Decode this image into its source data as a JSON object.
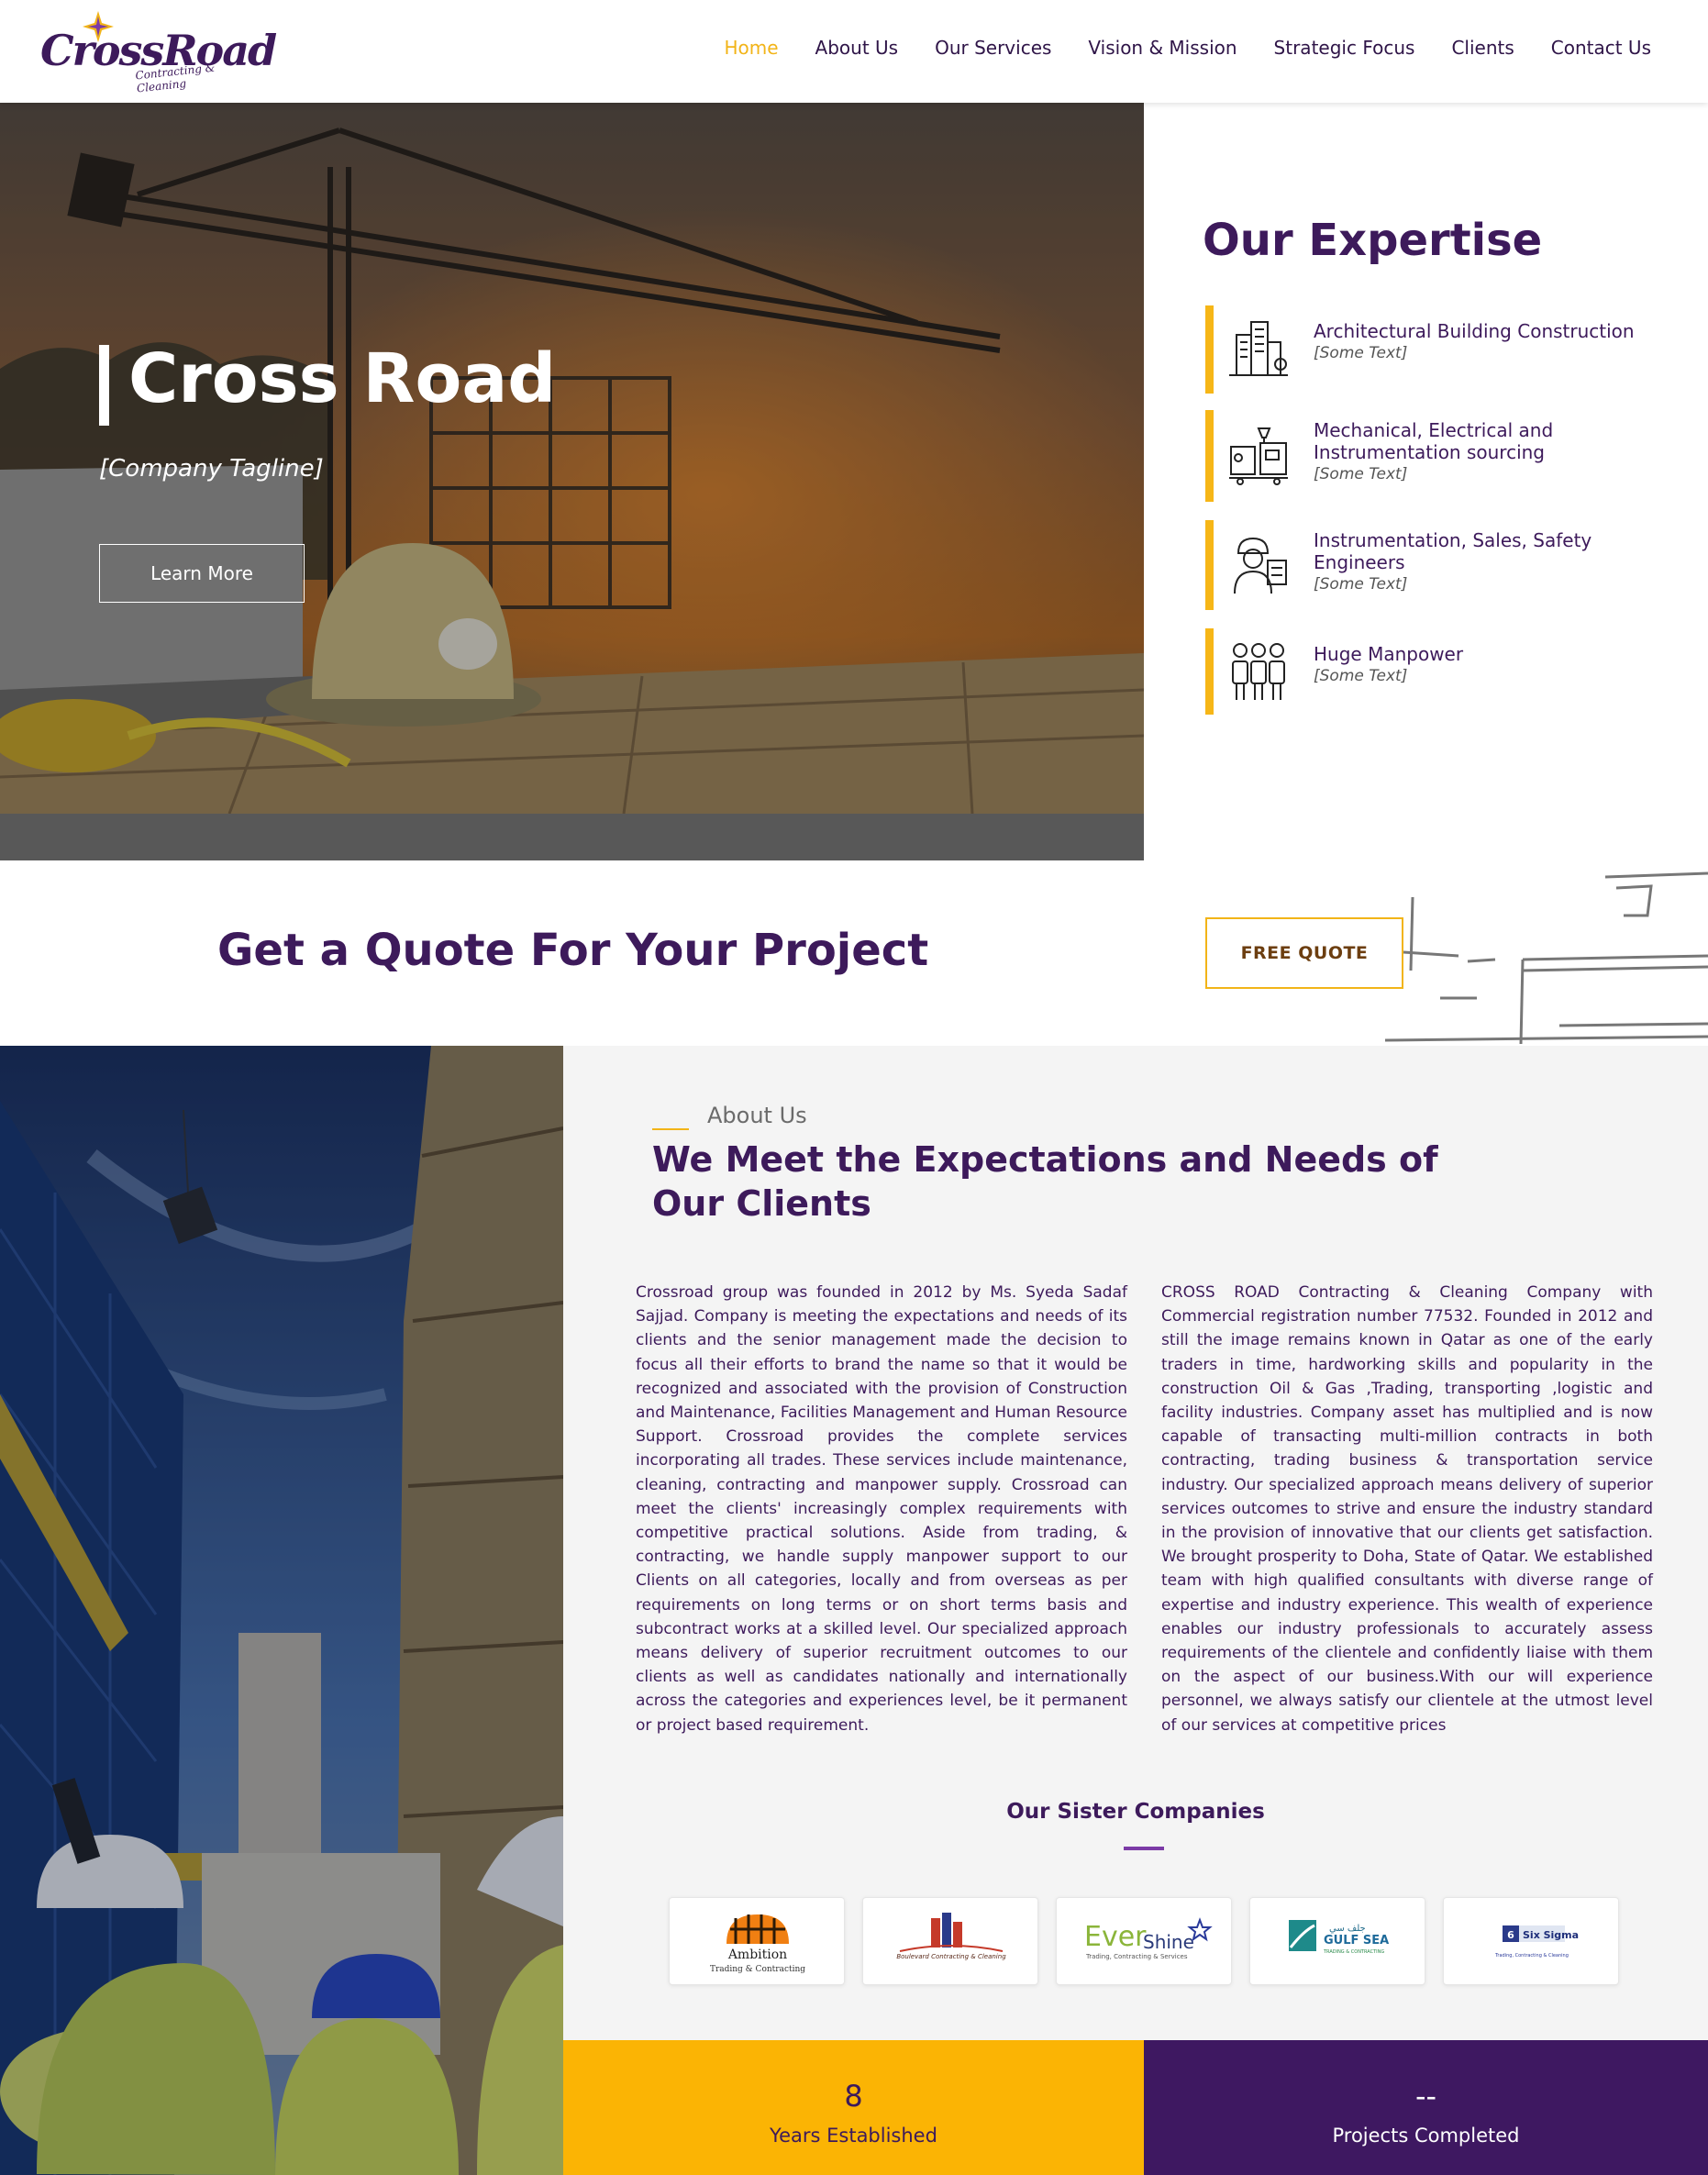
{
  "brand": {
    "logo_main": "CrossRoad",
    "logo_sub": "Contracting & Cleaning"
  },
  "nav": {
    "items": [
      {
        "label": "Home",
        "active": true
      },
      {
        "label": "About Us"
      },
      {
        "label": "Our Services"
      },
      {
        "label": "Vision & Mission"
      },
      {
        "label": "Strategic Focus"
      },
      {
        "label": "Clients"
      },
      {
        "label": "Contact Us"
      }
    ]
  },
  "hero": {
    "title": "Cross Road",
    "tagline": "[Company Tagline]",
    "button_label": "Learn More"
  },
  "expertise": {
    "title": "Our Expertise",
    "items": [
      {
        "name": "Architectural Building Construction",
        "sub": "[Some Text]",
        "icon": "buildings-icon"
      },
      {
        "name": "Mechanical, Electrical and Instrumentation sourcing",
        "sub": "[Some Text]",
        "icon": "machinery-icon"
      },
      {
        "name": "Instrumentation, Sales, Safety Engineers",
        "sub": "[Some Text]",
        "icon": "engineer-icon"
      },
      {
        "name": "Huge Manpower",
        "sub": "[Some Text]",
        "icon": "workers-group-icon"
      }
    ]
  },
  "quote": {
    "title": "Get a Quote For Your Project",
    "button_label": "FREE QUOTE"
  },
  "about": {
    "label": "About Us",
    "title": "We Meet the Expectations and Needs of Our Clients",
    "col1": "Crossroad group was founded in 2012 by Ms. Syeda Sadaf Sajjad. Company is meeting the expectations and needs of its clients and the senior management made the decision to focus all their efforts to brand the name so that it would be recognized and associated with the provision of Construction and Maintenance, Facilities Management and Human Resource Support. Crossroad provides the complete services incorporating all trades. These services include maintenance, cleaning, contracting and manpower supply. Crossroad can meet the clients' increasingly complex requirements with competitive practical solutions. Aside from trading, & contracting, we handle supply manpower support to our Clients on all categories, locally and from overseas as per requirements on long terms or on short terms basis and subcontract works at a skilled level. Our specialized approach means delivery of superior recruitment outcomes to our clients as well as candidates nationally and internationally across the categories and experiences level, be it permanent or project based requirement.",
    "col2": "CROSS ROAD Contracting & Cleaning Company with Commercial registration number 77532. Founded in 2012 and still the image remains known in Qatar as one of the early traders in time, hardworking skills and popularity in the construction Oil & Gas ,Trading, transporting ,logistic and facility industries. Company asset has multiplied and is now capable of transacting multi-million contracts in both contracting, trading business & transportation service industry. Our specialized approach means delivery of superior services outcomes to strive and ensure the industry standard in the provision of innovative that our clients get satisfaction. We brought prosperity to Doha, State of Qatar. We established team with high qualified consultants with diverse range of expertise and industry experience. This wealth of experience enables our industry professionals to accurately assess requirements of the clientele and confidently liaise with them on the aspect of our business.With our will experience personnel, we always satisfy our clientele at the utmost level of our services at competitive prices"
  },
  "sister": {
    "title": "Our Sister Companies",
    "logos": [
      {
        "name": "Ambition",
        "sub": "Trading & Contracting"
      },
      {
        "name": "Boulevard Contracting & Cleaning"
      },
      {
        "name": "Ever",
        "name2": "Shine",
        "sub": "Trading, Contracting & Services"
      },
      {
        "name": "GULF SEA",
        "sub": "TRADING & CONTRACTING"
      },
      {
        "name": "Six Sigma",
        "sub": "Trading, Contracting & Cleaning"
      }
    ]
  },
  "stats": [
    {
      "value": "8",
      "label": "Years Established"
    },
    {
      "value": "--",
      "label": "Projects Completed"
    }
  ],
  "colors": {
    "primary": "#3d1a5b",
    "accent": "#f6b617",
    "stat_yellow": "#fbb404",
    "stat_purple": "#3e1861"
  }
}
